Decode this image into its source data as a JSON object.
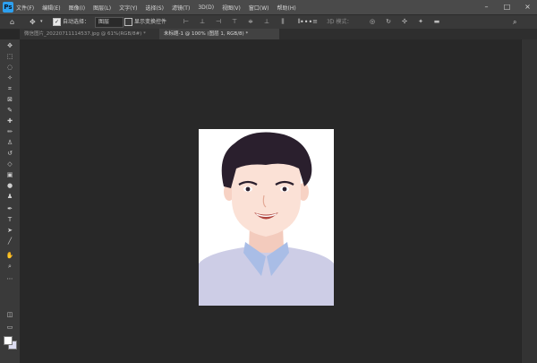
{
  "app": {
    "logo": "Ps"
  },
  "menubar": {
    "items": [
      "文件(F)",
      "编辑(E)",
      "图像(I)",
      "图层(L)",
      "文字(Y)",
      "选择(S)",
      "滤镜(T)",
      "3D(D)",
      "视图(V)",
      "窗口(W)",
      "帮助(H)"
    ]
  },
  "options": {
    "auto_select_label": "自动选择：",
    "auto_select_value": "图层",
    "show_transform_label": "显示变换控件",
    "mode_label": "3D 模式："
  },
  "tabs": [
    {
      "label": "微信图片_20220711114537.jpg @ 61%(RGB/8#) *",
      "active": false
    },
    {
      "label": "未标题-1 @ 100% (图层 1, RGB/8) *",
      "active": true
    }
  ],
  "toolbar": {
    "tools": [
      "move-tool",
      "marquee-tool",
      "lasso-tool",
      "magic-wand-tool",
      "crop-tool",
      "frame-tool",
      "eyedropper-tool",
      "healing-brush-tool",
      "brush-tool",
      "clone-stamp-tool",
      "history-brush-tool",
      "eraser-tool",
      "gradient-tool",
      "blur-tool",
      "dodge-tool",
      "pen-tool",
      "type-tool",
      "path-selection-tool",
      "rectangle-tool",
      "hand-tool",
      "zoom-tool",
      "more-tools"
    ],
    "foreground_color": "#ffffff",
    "background_color": "#dcdcf0"
  },
  "colors": {
    "menubar": "#4a4a4a",
    "optionsbar": "#393939",
    "canvas_bg": "#282828",
    "toolbar": "#3a3a3a",
    "hair": "#2a1f2d",
    "skin": "#fbe1d6",
    "shirt": "#cdcde6",
    "collar": "#a9bde6",
    "lips": "#b0443e"
  }
}
